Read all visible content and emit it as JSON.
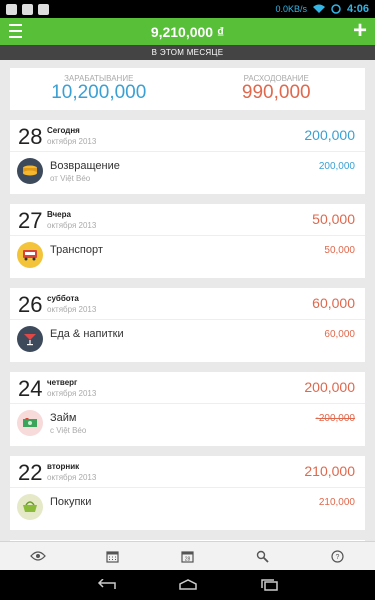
{
  "status": {
    "net": "0.0KB/s",
    "time": "4:06"
  },
  "header": {
    "balance": "9,210,000 ₫",
    "period": "В ЭТОМ МЕСЯЦЕ"
  },
  "summary": {
    "earn_label": "ЗАРАБАТЫВАНИЕ",
    "earn_value": "10,200,000",
    "spend_label": "РАСХОДОВАНИЕ",
    "spend_value": "990,000"
  },
  "days": [
    {
      "day": "28",
      "weekday": "Сегодня",
      "month": "октября 2013",
      "total": "200,000",
      "total_color": "blue",
      "item": {
        "category": "Возвращение",
        "note": "от Việt Béo",
        "amount": "200,000",
        "icon": "coins-icon"
      }
    },
    {
      "day": "27",
      "weekday": "Вчера",
      "month": "октября 2013",
      "total": "50,000",
      "total_color": "red",
      "item": {
        "category": "Транспорт",
        "note": "",
        "amount": "50,000",
        "icon": "bus-icon"
      }
    },
    {
      "day": "26",
      "weekday": "суббота",
      "month": "октября 2013",
      "total": "60,000",
      "total_color": "red",
      "item": {
        "category": "Еда & напитки",
        "note": "",
        "amount": "60,000",
        "icon": "cocktail-icon"
      }
    },
    {
      "day": "24",
      "weekday": "четверг",
      "month": "октября 2013",
      "total": "200,000",
      "total_color": "red",
      "item": {
        "category": "Займ",
        "note": "с Việt Béo",
        "amount": "-200,000",
        "icon": "cash-icon"
      }
    },
    {
      "day": "22",
      "weekday": "вторник",
      "month": "октября 2013",
      "total": "210,000",
      "total_color": "red",
      "item": {
        "category": "Покупки",
        "note": "",
        "amount": "210,000",
        "icon": "basket-icon"
      }
    }
  ],
  "tabs": [
    "eye-icon",
    "calendar-month-icon",
    "calendar-day-icon",
    "search-icon",
    "help-icon"
  ],
  "colors": {
    "accent": "#58bf38",
    "income": "#3aa0d4",
    "expense": "#e0684c"
  }
}
